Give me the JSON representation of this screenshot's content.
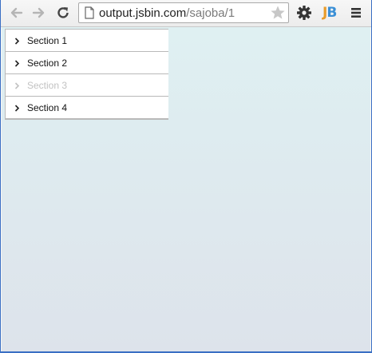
{
  "browser": {
    "url_host": "output.jsbin.com",
    "url_path": "/sajoba/1",
    "extension_label_j": "J",
    "extension_label_b": "B",
    "extension_color_j": "#e89b2a",
    "extension_color_b": "#3a8fd6"
  },
  "accordion": {
    "items": [
      {
        "label": "Section 1",
        "disabled": false
      },
      {
        "label": "Section 2",
        "disabled": false
      },
      {
        "label": "Section 3",
        "disabled": true
      },
      {
        "label": "Section 4",
        "disabled": false
      }
    ]
  },
  "colors": {
    "page_gradient_top": "#dff0f2",
    "page_gradient_bottom": "#dde3eb",
    "disabled_text": "#c2c2c2"
  },
  "icons": {
    "back": "arrow-left-icon",
    "forward": "arrow-right-icon",
    "reload": "reload-icon",
    "page": "page-icon",
    "star": "star-icon",
    "settings": "gear-icon",
    "menu": "hamburger-menu-icon",
    "chevron": "chevron-right-icon"
  }
}
